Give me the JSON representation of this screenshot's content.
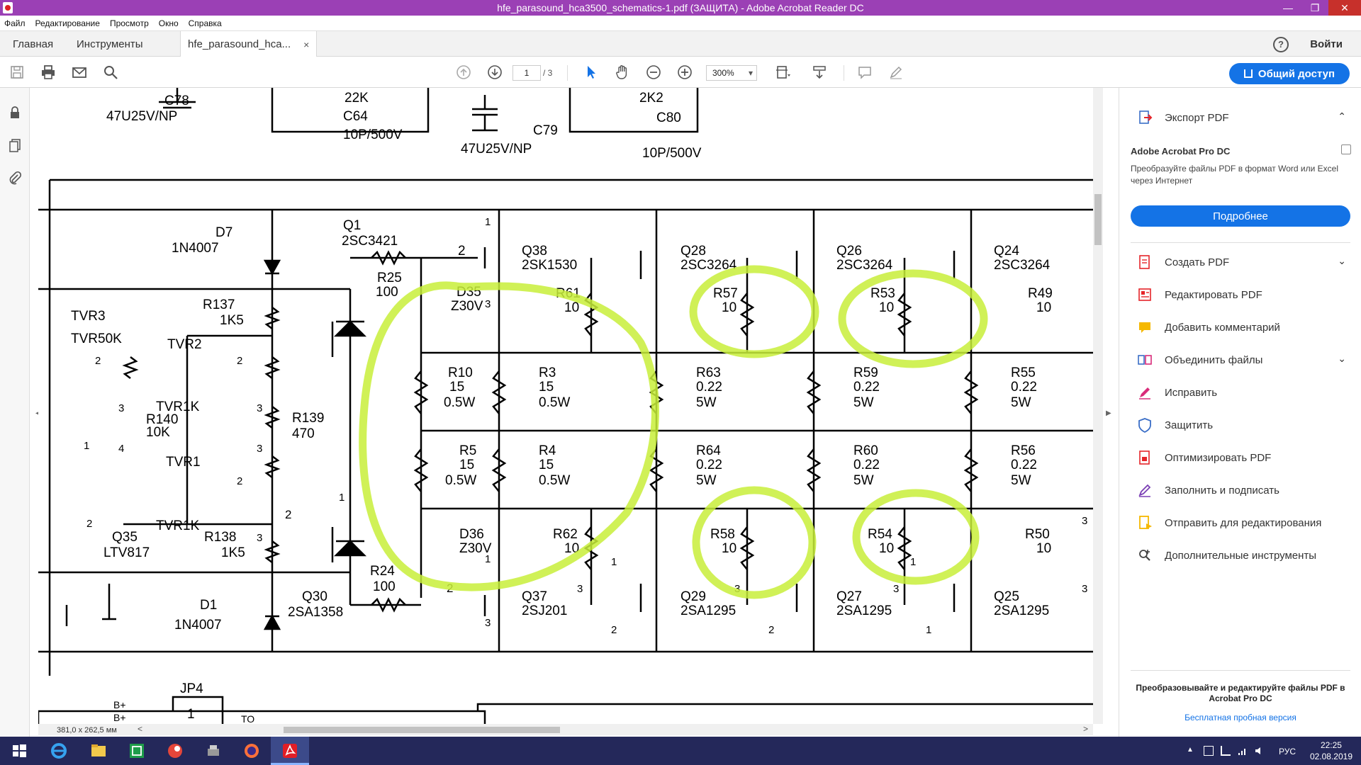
{
  "window": {
    "title": "hfe_parasound_hca3500_schematics-1.pdf (ЗАЩИТА) - Adobe Acrobat Reader DC",
    "minimize": "—",
    "restore": "❐",
    "close": "✕"
  },
  "menu": [
    "Файл",
    "Редактирование",
    "Просмотр",
    "Окно",
    "Справка"
  ],
  "tabs": {
    "home": "Главная",
    "tools": "Инструменты",
    "document": "hfe_parasound_hca...",
    "close": "×"
  },
  "header": {
    "help": "?",
    "signin": "Войти"
  },
  "toolbar": {
    "page_current": "1",
    "page_total": "/ 3",
    "zoom": "300%",
    "share": "Общий доступ"
  },
  "document": {
    "size": "381,0 x 262,5 мм",
    "scroll_left": "<",
    "scroll_right": ">"
  },
  "schematic": {
    "labels": [
      "C78",
      "47U25V/NP",
      "22K",
      "C64",
      "10P/500V",
      "C79",
      "47U25V/NP",
      "2K2",
      "C80",
      "10P/500V",
      "D7",
      "1N4007",
      "Q1",
      "2SC3421",
      "R25",
      "100",
      "2",
      "Q38",
      "2SK1530",
      "D35",
      "Z30V",
      "R61",
      "10",
      "Q28",
      "2SC3264",
      "R57",
      "10",
      "Q26",
      "2SC3264",
      "R53",
      "10",
      "Q24",
      "2SC3264",
      "R49",
      "10",
      "TVR3",
      "TVR50K",
      "R137",
      "1K5",
      "TVR2",
      "TVR1K",
      "R140",
      "10K",
      "R139",
      "470",
      "TVR1",
      "TVR1K",
      "R10",
      "15",
      "0.5W",
      "R3",
      "15",
      "0.5W",
      "R63",
      "0.22",
      "5W",
      "R59",
      "0.22",
      "5W",
      "R55",
      "0.22",
      "5W",
      "R5",
      "15",
      "0.5W",
      "R4",
      "15",
      "0.5W",
      "R64",
      "0.22",
      "5W",
      "R60",
      "0.22",
      "5W",
      "R56",
      "0.22",
      "5W",
      "Q35",
      "LTV817",
      "R138",
      "1K5",
      "D36",
      "Z30V",
      "R62",
      "10",
      "R58",
      "10",
      "R54",
      "10",
      "R50",
      "10",
      "R24",
      "100",
      "Q30",
      "2SA1358",
      "D1",
      "1N4007",
      "Q37",
      "2SJ201",
      "Q29",
      "2SA1295",
      "Q27",
      "2SA1295",
      "Q25",
      "2SA1295",
      "JP4",
      "1",
      "B+",
      "B+",
      "TO"
    ],
    "pins": [
      "2",
      "3",
      "1",
      "4",
      "2",
      "3",
      "2",
      "3",
      "1",
      "2",
      "1",
      "3",
      "2",
      "1",
      "3",
      "3",
      "1",
      "1",
      "2",
      "3",
      "2",
      "3",
      "2",
      "3",
      "1",
      "3",
      "3"
    ]
  },
  "rightpane": {
    "export_pdf": "Экспорт PDF",
    "pro_title": "Adobe Acrobat Pro DC",
    "pro_desc": "Преобразуйте файлы PDF в формат Word или Excel через Интернет",
    "more": "Подробнее",
    "tools": [
      {
        "label": "Создать PDF",
        "icon": "create-pdf-icon",
        "color": "#e5252a",
        "chevron": true
      },
      {
        "label": "Редактировать PDF",
        "icon": "edit-pdf-icon",
        "color": "#e5252a",
        "chevron": false
      },
      {
        "label": "Добавить комментарий",
        "icon": "comment-icon",
        "color": "#f5b800",
        "chevron": false
      },
      {
        "label": "Объединить файлы",
        "icon": "combine-files-icon",
        "color": "#3a6ec7",
        "chevron": true
      },
      {
        "label": "Исправить",
        "icon": "fill-edit-icon",
        "color": "#d92b7a",
        "chevron": false
      },
      {
        "label": "Защитить",
        "icon": "protect-shield-icon",
        "color": "#3a6ec7",
        "chevron": false
      },
      {
        "label": "Оптимизировать PDF",
        "icon": "optimize-pdf-icon",
        "color": "#e5252a",
        "chevron": false
      },
      {
        "label": "Заполнить и подписать",
        "icon": "fill-sign-icon",
        "color": "#7b3fb5",
        "chevron": false
      },
      {
        "label": "Отправить для редактирования",
        "icon": "send-review-icon",
        "color": "#f5b800",
        "chevron": false
      },
      {
        "label": "Дополнительные инструменты",
        "icon": "more-tools-icon",
        "color": "#444444",
        "chevron": false
      }
    ],
    "chevron_up": "⌃",
    "chevron_down": "⌄",
    "promo_title": "Преобразовывайте и редактируйте файлы PDF в Acrobat Pro DC",
    "promo_link": "Бесплатная пробная версия"
  },
  "taskbar": {
    "language": "РУС",
    "time": "22:25",
    "date": "02.08.2019"
  },
  "colors": {
    "titlebar": "#9b40b5",
    "accent": "#1473e6",
    "highlight": "#c8ee3a",
    "taskbar": "#24285a"
  }
}
